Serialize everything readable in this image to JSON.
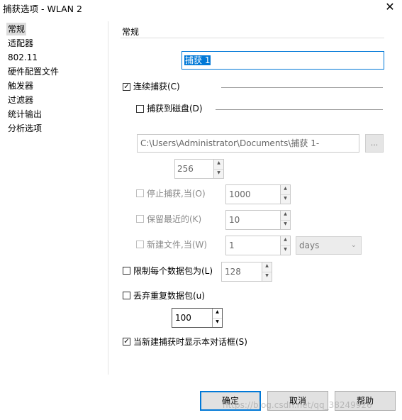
{
  "window": {
    "title": "捕获选项 - WLAN 2"
  },
  "sidebar": {
    "items": [
      {
        "label": "常规",
        "selected": true
      },
      {
        "label": "适配器"
      },
      {
        "label": "802.11"
      },
      {
        "label": "硬件配置文件"
      },
      {
        "label": "触发器"
      },
      {
        "label": "过滤器"
      },
      {
        "label": "统计输出"
      },
      {
        "label": "分析选项"
      }
    ]
  },
  "section": {
    "title": "常规"
  },
  "capture_name": {
    "value": "捕获 1"
  },
  "continuous_capture": {
    "label": "连续捕获(C)",
    "checked": true
  },
  "capture_to_disk": {
    "label": "捕获到磁盘(D)",
    "checked": false
  },
  "file_path": {
    "value": "C:\\Users\\Administrator\\Documents\\捕获 1-",
    "browse_label": "..."
  },
  "buffer_size": {
    "value": "256"
  },
  "stop_capture": {
    "label": "停止捕获,当(O)",
    "value": "1000"
  },
  "keep_recent": {
    "label": "保留最近的(K)",
    "value": "10"
  },
  "new_file": {
    "label": "新建文件,当(W)",
    "value": "1",
    "unit": "days"
  },
  "limit_packet": {
    "label": "限制每个数据包为(L)",
    "value": "128",
    "checked": false
  },
  "discard_duplicates": {
    "label": "丢弃重复数据包(u)",
    "value": "100",
    "checked": false
  },
  "show_dialog": {
    "label": "当新建捕获时显示本对话框(S)",
    "checked": true
  },
  "buttons": {
    "ok": "确定",
    "cancel": "取消",
    "help": "帮助"
  },
  "watermark": "https://blog.csdn.net/qq_38249926",
  "icons": {
    "check": "✓",
    "close": "✕",
    "up": "▲",
    "down": "▼",
    "dropdown": "⌄"
  }
}
